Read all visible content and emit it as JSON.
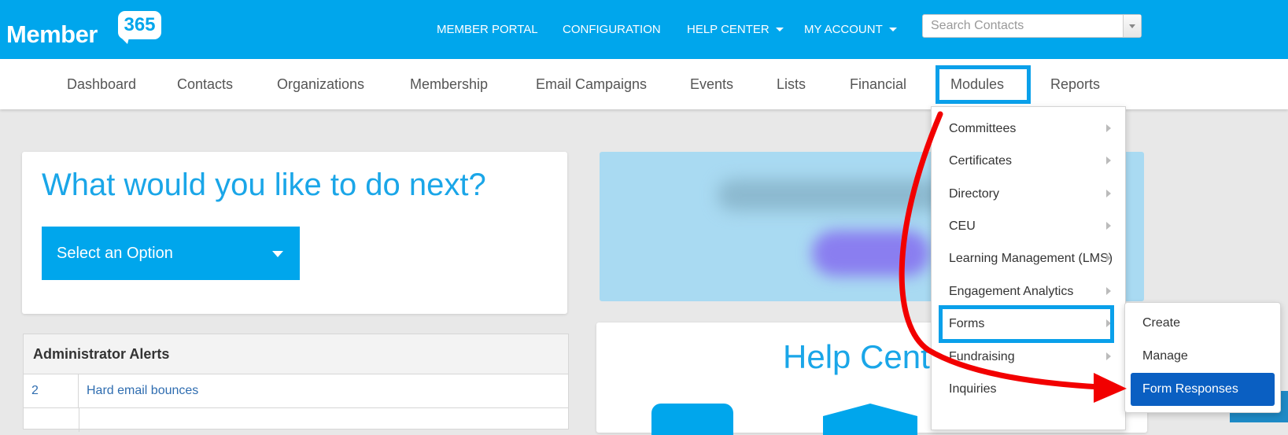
{
  "header": {
    "logo_text": "Member",
    "logo_badge": "365",
    "nav": {
      "member_portal": "MEMBER PORTAL",
      "configuration": "CONFIGURATION",
      "help_center": "HELP CENTER",
      "my_account": "MY ACCOUNT"
    },
    "search": {
      "placeholder": "Search Contacts"
    }
  },
  "main_nav": {
    "dashboard": "Dashboard",
    "contacts": "Contacts",
    "organizations": "Organizations",
    "membership": "Membership",
    "email_campaigns": "Email Campaigns",
    "events": "Events",
    "lists": "Lists",
    "financial": "Financial",
    "modules": "Modules",
    "reports": "Reports"
  },
  "next_panel": {
    "title": "What would you like to do next?",
    "select_label": "Select an Option"
  },
  "alerts": {
    "title": "Administrator Alerts",
    "rows": [
      {
        "count": "2",
        "label": "Hard email bounces"
      }
    ]
  },
  "help_panel": {
    "title": "Help Cente"
  },
  "modules_menu": {
    "items": [
      {
        "label": "Committees",
        "has_sub": true
      },
      {
        "label": "Certificates",
        "has_sub": true
      },
      {
        "label": "Directory",
        "has_sub": true
      },
      {
        "label": "CEU",
        "has_sub": true
      },
      {
        "label": "Learning Management (LMS)",
        "has_sub": true
      },
      {
        "label": "Engagement Analytics",
        "has_sub": true
      },
      {
        "label": "Forms",
        "has_sub": true
      },
      {
        "label": "Fundraising",
        "has_sub": true
      },
      {
        "label": "Inquiries",
        "has_sub": false
      }
    ]
  },
  "forms_submenu": {
    "items": [
      "Create",
      "Manage",
      "Form Responses"
    ]
  },
  "colors": {
    "brand_blue": "#00a6ec",
    "highlight_box": "#0aa0ea",
    "annotation_arrow": "#f20000",
    "active_submenu": "#0a5fc2"
  }
}
